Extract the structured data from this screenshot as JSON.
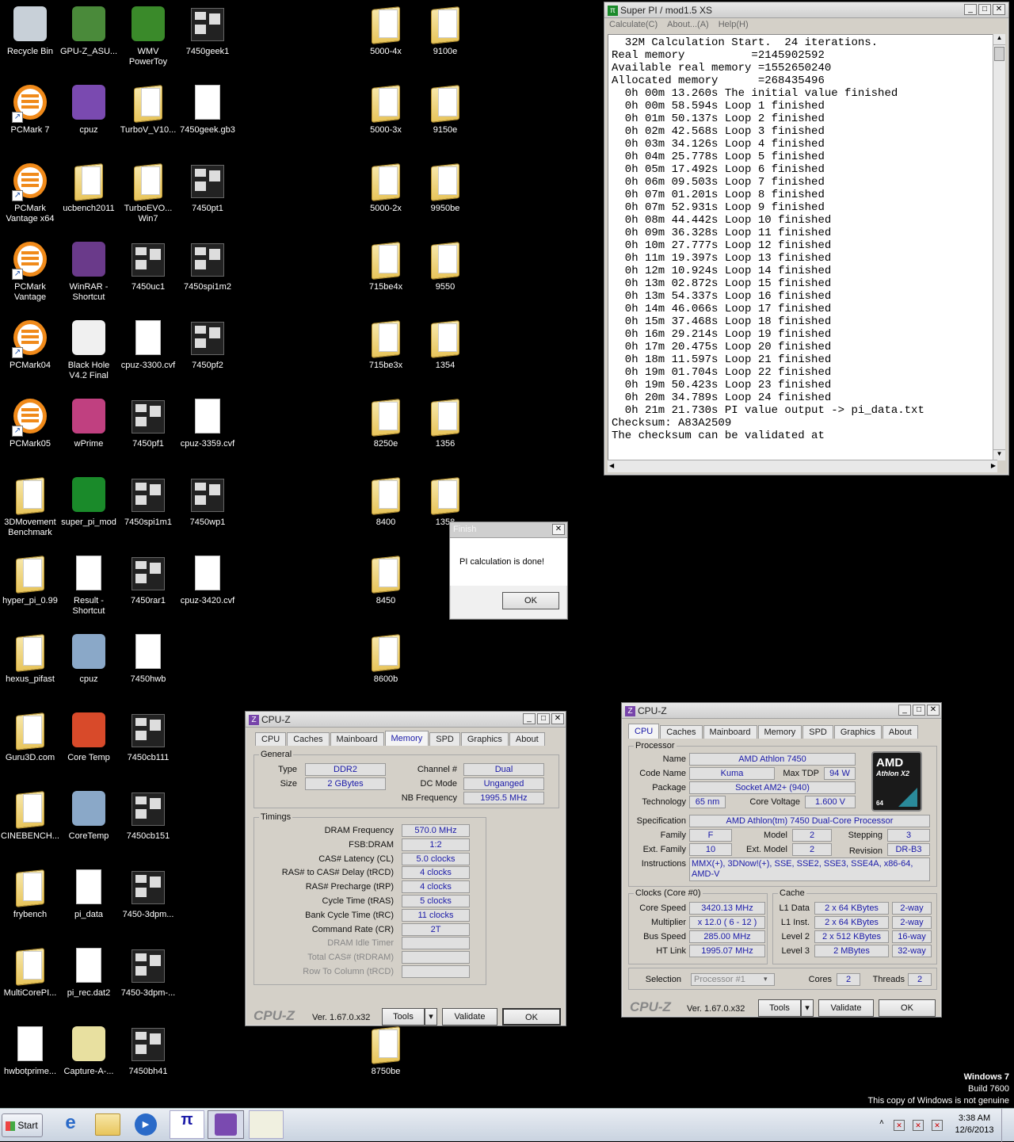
{
  "desktop_icons": [
    {
      "label": "Recycle Bin",
      "icon": "recycle-bin-icon",
      "kind": "app",
      "color": "#c8d0d8",
      "x": 0,
      "y": 0
    },
    {
      "label": "GPU-Z_ASU...",
      "icon": "gpuz-icon",
      "kind": "app",
      "color": "#4a8a3a",
      "x": 1,
      "y": 0
    },
    {
      "label": "WMV PowerToy",
      "icon": "windows-logo-icon",
      "kind": "app",
      "color": "#3a8a2a",
      "x": 2,
      "y": 0
    },
    {
      "label": "7450geek1",
      "icon": "screenshot-icon",
      "kind": "shot",
      "x": 3,
      "y": 0
    },
    {
      "label": "PCMark 7",
      "icon": "pcmark-icon",
      "kind": "pcm",
      "x": 0,
      "y": 1
    },
    {
      "label": "cpuz",
      "icon": "cpuz-icon",
      "kind": "app",
      "color": "#7a4ab0",
      "x": 1,
      "y": 1
    },
    {
      "label": "TurboV_V10...",
      "icon": "folder-icon",
      "kind": "folder",
      "x": 2,
      "y": 1
    },
    {
      "label": "7450geek.gb3",
      "icon": "file-icon",
      "kind": "file",
      "x": 3,
      "y": 1
    },
    {
      "label": "PCMark Vantage x64",
      "icon": "pcmark-icon",
      "kind": "pcm",
      "x": 0,
      "y": 2
    },
    {
      "label": "ucbench2011",
      "icon": "folder-icon",
      "kind": "folder",
      "x": 1,
      "y": 2
    },
    {
      "label": "TurboEVO... Win7",
      "icon": "folder-icon",
      "kind": "folder",
      "x": 2,
      "y": 2
    },
    {
      "label": "7450pt1",
      "icon": "screenshot-icon",
      "kind": "shot",
      "x": 3,
      "y": 2
    },
    {
      "label": "PCMark Vantage",
      "icon": "pcmark-icon",
      "kind": "pcm",
      "x": 0,
      "y": 3
    },
    {
      "label": "WinRAR - Shortcut",
      "icon": "winrar-icon",
      "kind": "app",
      "color": "#6a3a8a",
      "x": 1,
      "y": 3
    },
    {
      "label": "7450uc1",
      "icon": "screenshot-icon",
      "kind": "shot",
      "x": 2,
      "y": 3
    },
    {
      "label": "7450spi1m2",
      "icon": "screenshot-icon",
      "kind": "shot",
      "x": 3,
      "y": 3
    },
    {
      "label": "PCMark04",
      "icon": "pcmark-icon",
      "kind": "pcm",
      "x": 0,
      "y": 4
    },
    {
      "label": "Black Hole V4.2 Final",
      "icon": "blackhole-icon",
      "kind": "app",
      "color": "#f0f0f0",
      "x": 1,
      "y": 4
    },
    {
      "label": "cpuz-3300.cvf",
      "icon": "file-icon",
      "kind": "file",
      "x": 2,
      "y": 4
    },
    {
      "label": "7450pf2",
      "icon": "screenshot-icon",
      "kind": "shot",
      "x": 3,
      "y": 4
    },
    {
      "label": "PCMark05",
      "icon": "pcmark-icon",
      "kind": "pcm",
      "x": 0,
      "y": 5
    },
    {
      "label": "wPrime",
      "icon": "wprime-icon",
      "kind": "app",
      "color": "#c04080",
      "x": 1,
      "y": 5
    },
    {
      "label": "7450pf1",
      "icon": "screenshot-icon",
      "kind": "shot",
      "x": 2,
      "y": 5
    },
    {
      "label": "cpuz-3359.cvf",
      "icon": "file-icon",
      "kind": "file",
      "x": 3,
      "y": 5
    },
    {
      "label": "3DMovement Benchmark",
      "icon": "folder-icon",
      "kind": "folder",
      "x": 0,
      "y": 6
    },
    {
      "label": "super_pi_mod",
      "icon": "superpi-icon",
      "kind": "app",
      "color": "#1a8a2a",
      "x": 1,
      "y": 6
    },
    {
      "label": "7450spi1m1",
      "icon": "screenshot-icon",
      "kind": "shot",
      "x": 2,
      "y": 6
    },
    {
      "label": "7450wp1",
      "icon": "screenshot-icon",
      "kind": "shot",
      "x": 3,
      "y": 6
    },
    {
      "label": "hyper_pi_0.99",
      "icon": "folder-icon",
      "kind": "folder",
      "x": 0,
      "y": 7
    },
    {
      "label": "Result - Shortcut",
      "icon": "document-icon",
      "kind": "file",
      "x": 1,
      "y": 7
    },
    {
      "label": "7450rar1",
      "icon": "screenshot-icon",
      "kind": "shot",
      "x": 2,
      "y": 7
    },
    {
      "label": "cpuz-3420.cvf",
      "icon": "file-icon",
      "kind": "file",
      "x": 3,
      "y": 7
    },
    {
      "label": "hexus_pifast",
      "icon": "folder-icon",
      "kind": "folder",
      "x": 0,
      "y": 8
    },
    {
      "label": "cpuz",
      "icon": "gear-icon",
      "kind": "app",
      "color": "#8aa8c8",
      "x": 1,
      "y": 8
    },
    {
      "label": "7450hwb",
      "icon": "file-icon",
      "kind": "file",
      "x": 2,
      "y": 8
    },
    {
      "label": "Guru3D.com",
      "icon": "folder-icon",
      "kind": "folder",
      "x": 0,
      "y": 9
    },
    {
      "label": "Core Temp",
      "icon": "thermometer-icon",
      "kind": "app",
      "color": "#d84a2a",
      "x": 1,
      "y": 9
    },
    {
      "label": "7450cb111",
      "icon": "screenshot-icon",
      "kind": "shot",
      "x": 2,
      "y": 9
    },
    {
      "label": "CINEBENCH...",
      "icon": "folder-icon",
      "kind": "folder",
      "x": 0,
      "y": 10
    },
    {
      "label": "CoreTemp",
      "icon": "gear-icon",
      "kind": "app",
      "color": "#8aa8c8",
      "x": 1,
      "y": 10
    },
    {
      "label": "7450cb151",
      "icon": "screenshot-icon",
      "kind": "shot",
      "x": 2,
      "y": 10
    },
    {
      "label": "frybench",
      "icon": "folder-icon",
      "kind": "folder",
      "x": 0,
      "y": 11
    },
    {
      "label": "pi_data",
      "icon": "document-icon",
      "kind": "file",
      "x": 1,
      "y": 11
    },
    {
      "label": "7450-3dpm...",
      "icon": "screenshot-icon",
      "kind": "shot",
      "x": 2,
      "y": 11
    },
    {
      "label": "MultiCorePI...",
      "icon": "folder-icon",
      "kind": "folder",
      "x": 0,
      "y": 12
    },
    {
      "label": "pi_rec.dat2",
      "icon": "file-icon",
      "kind": "file",
      "x": 1,
      "y": 12
    },
    {
      "label": "7450-3dpm-...",
      "icon": "screenshot-icon",
      "kind": "shot",
      "x": 2,
      "y": 12
    },
    {
      "label": "hwbotprime...",
      "icon": "java-icon",
      "kind": "file",
      "x": 0,
      "y": 13
    },
    {
      "label": "Capture-A-...",
      "icon": "capture-icon",
      "kind": "app",
      "color": "#e8e0a0",
      "x": 1,
      "y": 13
    },
    {
      "label": "7450bh41",
      "icon": "screenshot-icon",
      "kind": "shot",
      "x": 2,
      "y": 13
    },
    {
      "label": "5000-4x",
      "icon": "folder-icon",
      "kind": "folder",
      "x": 6,
      "y": 0
    },
    {
      "label": "9100e",
      "icon": "folder-icon",
      "kind": "folder",
      "x": 7,
      "y": 0
    },
    {
      "label": "5000-3x",
      "icon": "folder-icon",
      "kind": "folder",
      "x": 6,
      "y": 1
    },
    {
      "label": "9150e",
      "icon": "folder-icon",
      "kind": "folder",
      "x": 7,
      "y": 1
    },
    {
      "label": "5000-2x",
      "icon": "folder-icon",
      "kind": "folder",
      "x": 6,
      "y": 2
    },
    {
      "label": "9950be",
      "icon": "folder-icon",
      "kind": "folder",
      "x": 7,
      "y": 2
    },
    {
      "label": "715be4x",
      "icon": "folder-icon",
      "kind": "folder",
      "x": 6,
      "y": 3
    },
    {
      "label": "9550",
      "icon": "folder-icon",
      "kind": "folder",
      "x": 7,
      "y": 3
    },
    {
      "label": "715be3x",
      "icon": "folder-icon",
      "kind": "folder",
      "x": 6,
      "y": 4
    },
    {
      "label": "1354",
      "icon": "folder-icon",
      "kind": "folder",
      "x": 7,
      "y": 4
    },
    {
      "label": "8250e",
      "icon": "folder-icon",
      "kind": "folder",
      "x": 6,
      "y": 5
    },
    {
      "label": "1356",
      "icon": "folder-icon",
      "kind": "folder",
      "x": 7,
      "y": 5
    },
    {
      "label": "8400",
      "icon": "folder-icon",
      "kind": "folder",
      "x": 6,
      "y": 6
    },
    {
      "label": "1358",
      "icon": "folder-icon",
      "kind": "folder",
      "x": 7,
      "y": 6
    },
    {
      "label": "8450",
      "icon": "folder-icon",
      "kind": "folder",
      "x": 6,
      "y": 7
    },
    {
      "label": "8600b",
      "icon": "folder-icon",
      "kind": "folder",
      "x": 6,
      "y": 8
    },
    {
      "label": "8750be",
      "icon": "folder-icon",
      "kind": "folder",
      "x": 6,
      "y": 13
    }
  ],
  "superpi": {
    "title": "Super PI / mod1.5 XS",
    "menu": [
      "Calculate(C)",
      "About...(A)",
      "Help(H)"
    ],
    "lines": [
      "  32M Calculation Start.  24 iterations.",
      "Real memory          =2145902592",
      "Available real memory =1552650240",
      "Allocated memory      =268435496",
      "  0h 00m 13.260s The initial value finished",
      "  0h 00m 58.594s Loop 1 finished",
      "  0h 01m 50.137s Loop 2 finished",
      "  0h 02m 42.568s Loop 3 finished",
      "  0h 03m 34.126s Loop 4 finished",
      "  0h 04m 25.778s Loop 5 finished",
      "  0h 05m 17.492s Loop 6 finished",
      "  0h 06m 09.503s Loop 7 finished",
      "  0h 07m 01.201s Loop 8 finished",
      "  0h 07m 52.931s Loop 9 finished",
      "  0h 08m 44.442s Loop 10 finished",
      "  0h 09m 36.328s Loop 11 finished",
      "  0h 10m 27.777s Loop 12 finished",
      "  0h 11m 19.397s Loop 13 finished",
      "  0h 12m 10.924s Loop 14 finished",
      "  0h 13m 02.872s Loop 15 finished",
      "  0h 13m 54.337s Loop 16 finished",
      "  0h 14m 46.066s Loop 17 finished",
      "  0h 15m 37.468s Loop 18 finished",
      "  0h 16m 29.214s Loop 19 finished",
      "  0h 17m 20.475s Loop 20 finished",
      "  0h 18m 11.597s Loop 21 finished",
      "  0h 19m 01.704s Loop 22 finished",
      "  0h 19m 50.423s Loop 23 finished",
      "  0h 20m 34.789s Loop 24 finished",
      "  0h 21m 21.730s PI value output -> pi_data.txt",
      "",
      "Checksum: A83A2509",
      "The checksum can be validated at"
    ]
  },
  "finish_dialog": {
    "title": "Finish",
    "message": "PI calculation is done!",
    "ok": "OK"
  },
  "cpuz_mem": {
    "title": "CPU-Z",
    "tabs": [
      "CPU",
      "Caches",
      "Mainboard",
      "Memory",
      "SPD",
      "Graphics",
      "About"
    ],
    "active_tab": "Memory",
    "general_title": "General",
    "type_label": "Type",
    "type": "DDR2",
    "size_label": "Size",
    "size": "2 GBytes",
    "channel_label": "Channel #",
    "channel": "Dual",
    "dcmode_label": "DC Mode",
    "dcmode": "Unganged",
    "nbfreq_label": "NB Frequency",
    "nbfreq": "1995.5 MHz",
    "timings_title": "Timings",
    "timings": [
      {
        "label": "DRAM Frequency",
        "value": "570.0 MHz"
      },
      {
        "label": "FSB:DRAM",
        "value": "1:2"
      },
      {
        "label": "CAS# Latency (CL)",
        "value": "5.0 clocks"
      },
      {
        "label": "RAS# to CAS# Delay (tRCD)",
        "value": "4 clocks"
      },
      {
        "label": "RAS# Precharge (tRP)",
        "value": "4 clocks"
      },
      {
        "label": "Cycle Time (tRAS)",
        "value": "5 clocks"
      },
      {
        "label": "Bank Cycle Time (tRC)",
        "value": "11 clocks"
      },
      {
        "label": "Command Rate (CR)",
        "value": "2T"
      },
      {
        "label": "DRAM Idle Timer",
        "value": "",
        "dim": true
      },
      {
        "label": "Total CAS# (tRDRAM)",
        "value": "",
        "dim": true
      },
      {
        "label": "Row To Column (tRCD)",
        "value": "",
        "dim": true
      }
    ],
    "brand": "CPU-Z",
    "version": "Ver. 1.67.0.x32",
    "tools": "Tools",
    "validate": "Validate",
    "ok": "OK"
  },
  "cpuz_cpu": {
    "title": "CPU-Z",
    "tabs": [
      "CPU",
      "Caches",
      "Mainboard",
      "Memory",
      "SPD",
      "Graphics",
      "About"
    ],
    "active_tab": "CPU",
    "processor_title": "Processor",
    "name_label": "Name",
    "name": "AMD Athlon 7450",
    "codename_label": "Code Name",
    "codename": "Kuma",
    "tdp_label": "Max TDP",
    "tdp": "94 W",
    "package_label": "Package",
    "package": "Socket AM2+ (940)",
    "tech_label": "Technology",
    "tech": "65 nm",
    "voltage_label": "Core Voltage",
    "voltage": "1.600 V",
    "spec_label": "Specification",
    "spec": "AMD Athlon(tm) 7450 Dual-Core Processor",
    "family_label": "Family",
    "family": "F",
    "model_label": "Model",
    "model": "2",
    "stepping_label": "Stepping",
    "stepping": "3",
    "extfamily_label": "Ext. Family",
    "extfamily": "10",
    "extmodel_label": "Ext. Model",
    "extmodel": "2",
    "revision_label": "Revision",
    "revision": "DR-B3",
    "instr_label": "Instructions",
    "instr": "MMX(+), 3DNow!(+), SSE, SSE2, SSE3, SSE4A, x86-64, AMD-V",
    "logo_top": "AMD",
    "logo_sub": "Athlon X2",
    "logo_64": "64",
    "clocks_title": "Clocks (Core #0)",
    "corespeed_label": "Core Speed",
    "corespeed": "3420.13 MHz",
    "mult_label": "Multiplier",
    "mult": "x 12.0 ( 6 - 12 )",
    "bus_label": "Bus Speed",
    "bus": "285.00 MHz",
    "ht_label": "HT Link",
    "ht": "1995.07 MHz",
    "cache_title": "Cache",
    "cache": [
      {
        "label": "L1 Data",
        "size": "2 x 64 KBytes",
        "way": "2-way"
      },
      {
        "label": "L1 Inst.",
        "size": "2 x 64 KBytes",
        "way": "2-way"
      },
      {
        "label": "Level 2",
        "size": "2 x 512 KBytes",
        "way": "16-way"
      },
      {
        "label": "Level 3",
        "size": "2 MBytes",
        "way": "32-way"
      }
    ],
    "selection_label": "Selection",
    "selection": "Processor #1",
    "cores_label": "Cores",
    "cores": "2",
    "threads_label": "Threads",
    "threads": "2",
    "brand": "CPU-Z",
    "version": "Ver. 1.67.0.x32",
    "tools": "Tools",
    "validate": "Validate",
    "ok": "OK"
  },
  "watermark": {
    "line1": "Windows 7",
    "line2": "Build 7600",
    "line3": "This copy of Windows is not genuine"
  },
  "taskbar": {
    "start": "Start",
    "time": "3:38 AM",
    "date": "12/6/2013"
  }
}
